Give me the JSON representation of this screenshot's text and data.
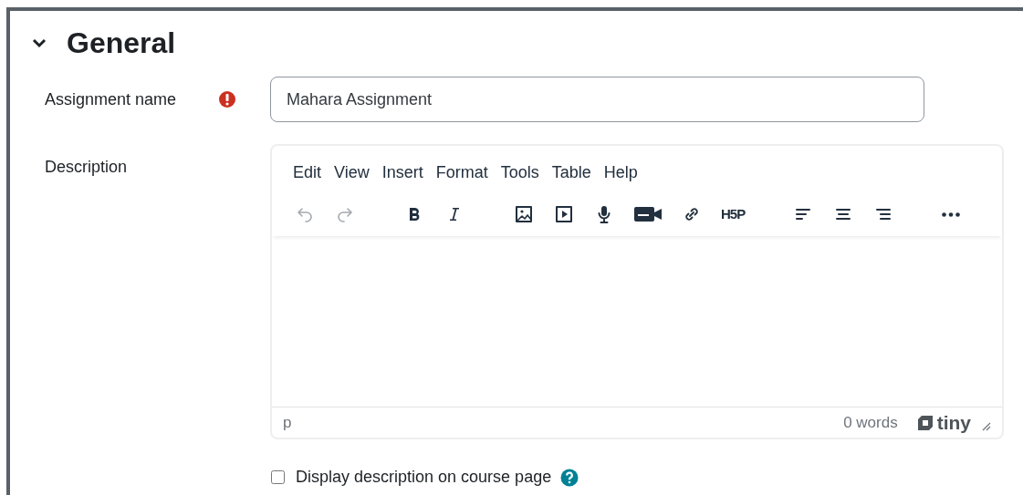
{
  "section": {
    "title": "General",
    "expanded": true
  },
  "assignment_name": {
    "label": "Assignment name",
    "required": true,
    "value": "Mahara Assignment"
  },
  "description": {
    "label": "Description",
    "menu": [
      "Edit",
      "View",
      "Insert",
      "Format",
      "Tools",
      "Table",
      "Help"
    ],
    "toolbar": [
      {
        "kind": "undo",
        "disabled": true
      },
      {
        "kind": "redo",
        "disabled": true
      },
      {
        "kind": "gap"
      },
      {
        "kind": "bold",
        "disabled": false
      },
      {
        "kind": "italic",
        "disabled": false
      },
      {
        "kind": "gap"
      },
      {
        "kind": "image",
        "disabled": false
      },
      {
        "kind": "media",
        "disabled": false
      },
      {
        "kind": "microphone",
        "disabled": false
      },
      {
        "kind": "camera",
        "disabled": false
      },
      {
        "kind": "link",
        "disabled": false
      },
      {
        "kind": "h5p",
        "disabled": false,
        "label": "H5P"
      },
      {
        "kind": "gap"
      },
      {
        "kind": "align-left",
        "disabled": false
      },
      {
        "kind": "align-center",
        "disabled": false
      },
      {
        "kind": "align-right",
        "disabled": false
      },
      {
        "kind": "gap"
      },
      {
        "kind": "more",
        "disabled": false
      }
    ],
    "path": "p",
    "word_count": "0 words",
    "brand": "tiny"
  },
  "display_description": {
    "label": "Display description on course page",
    "checked": false
  }
}
